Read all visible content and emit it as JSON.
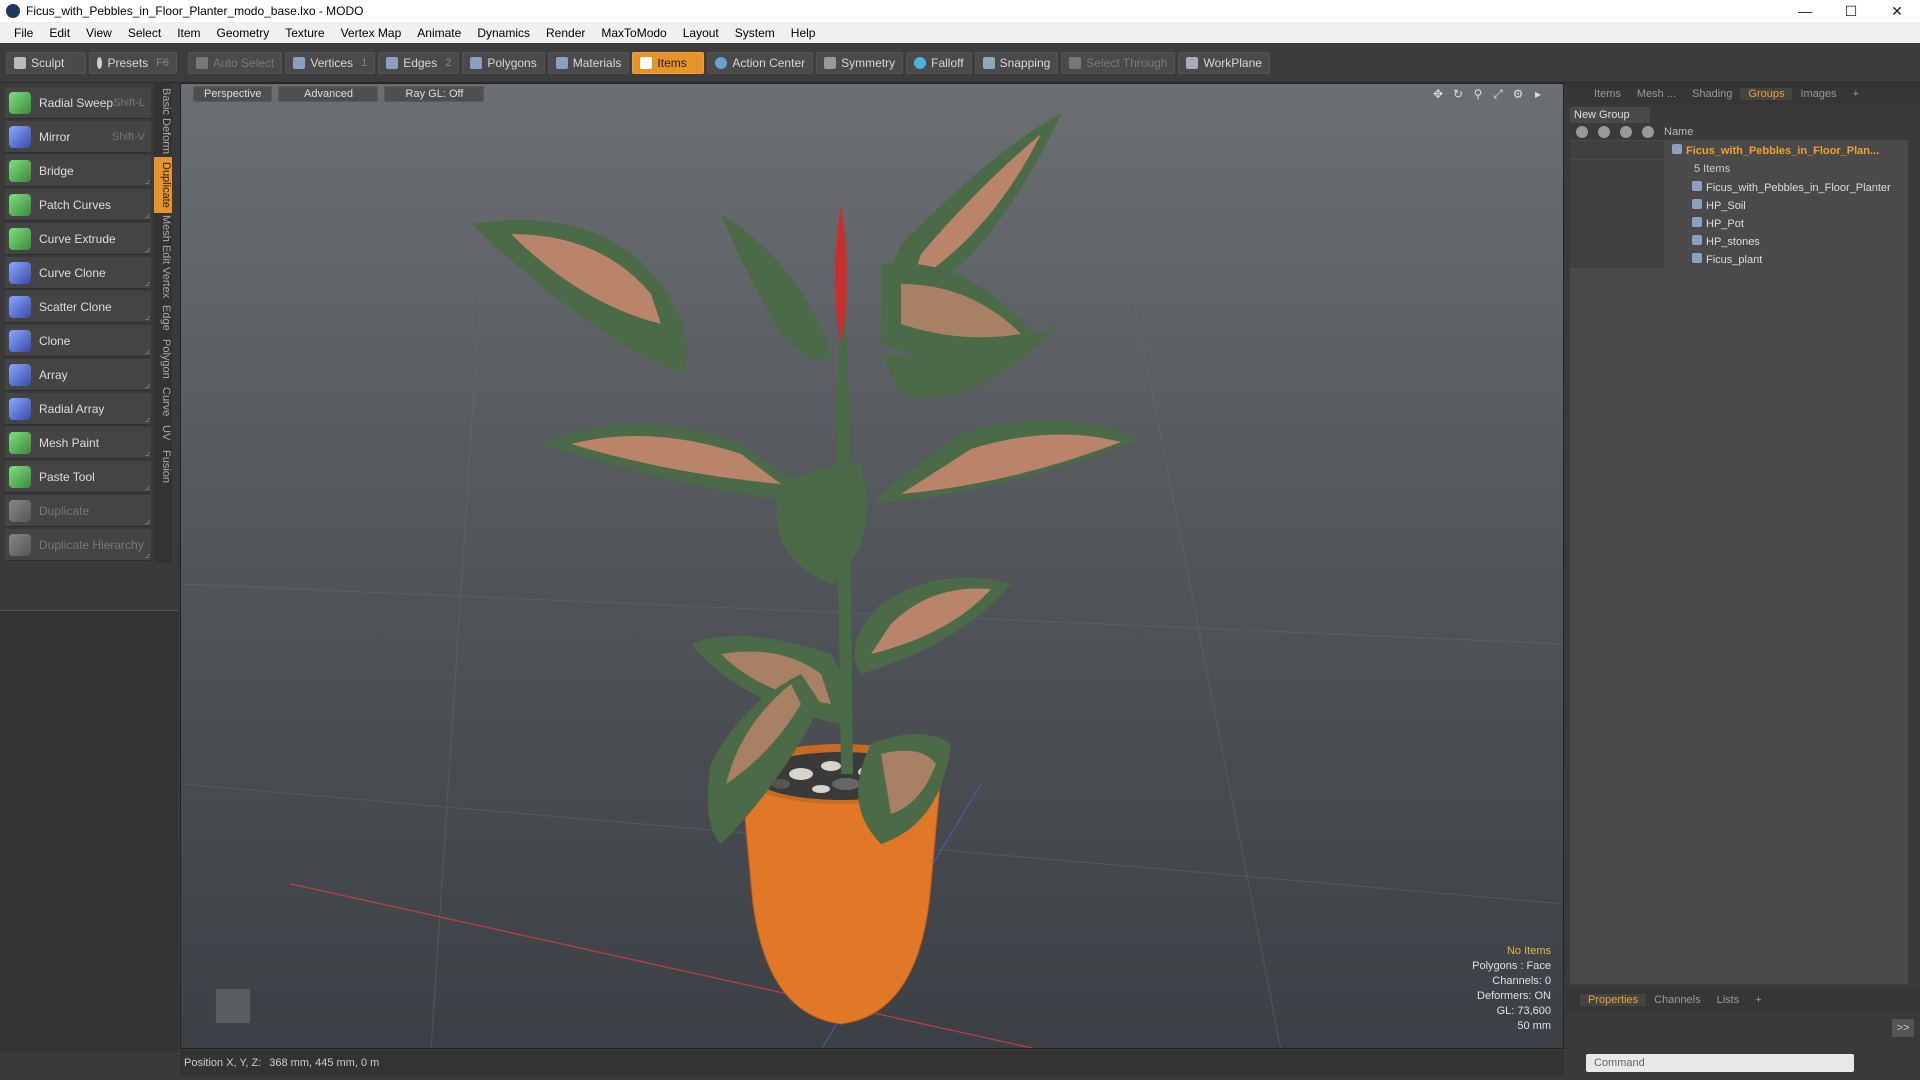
{
  "window": {
    "title": "Ficus_with_Pebbles_in_Floor_Planter_modo_base.lxo - MODO",
    "controls": [
      "—",
      "☐",
      "✕"
    ]
  },
  "menubar": [
    "File",
    "Edit",
    "View",
    "Select",
    "Item",
    "Geometry",
    "Texture",
    "Vertex Map",
    "Animate",
    "Dynamics",
    "Render",
    "MaxToModo",
    "Layout",
    "System",
    "Help"
  ],
  "toolbar": {
    "sculpt": "Sculpt",
    "presets": "Presets",
    "presets_key": "F6",
    "auto_select": "Auto Select",
    "vertices": "Vertices",
    "vertices_num": "1",
    "edges": "Edges",
    "edges_num": "2",
    "polygons": "Polygons",
    "materials": "Materials",
    "items": "Items",
    "action_center": "Action Center",
    "symmetry": "Symmetry",
    "falloff": "Falloff",
    "snapping": "Snapping",
    "select_through": "Select Through",
    "workplane": "WorkPlane"
  },
  "tools": [
    {
      "label": "Radial Sweep",
      "shortcut": "Shift-L",
      "icon": "radial-sweep-icon",
      "style": "green"
    },
    {
      "label": "Mirror",
      "shortcut": "Shift-V",
      "icon": "mirror-icon",
      "style": "blue"
    },
    {
      "label": "Bridge",
      "shortcut": "",
      "icon": "bridge-icon",
      "style": "green"
    },
    {
      "label": "Patch Curves",
      "shortcut": "",
      "icon": "patch-curves-icon",
      "style": "green"
    },
    {
      "label": "Curve Extrude",
      "shortcut": "",
      "icon": "curve-extrude-icon",
      "style": "green"
    },
    {
      "label": "Curve Clone",
      "shortcut": "",
      "icon": "curve-clone-icon",
      "style": "blue"
    },
    {
      "label": "Scatter Clone",
      "shortcut": "",
      "icon": "scatter-clone-icon",
      "style": "blue"
    },
    {
      "label": "Clone",
      "shortcut": "",
      "icon": "clone-icon",
      "style": "blue"
    },
    {
      "label": "Array",
      "shortcut": "",
      "icon": "array-icon",
      "style": "blue"
    },
    {
      "label": "Radial Array",
      "shortcut": "",
      "icon": "radial-array-icon",
      "style": "blue"
    },
    {
      "label": "Mesh Paint",
      "shortcut": "",
      "icon": "mesh-paint-icon",
      "style": "green"
    },
    {
      "label": "Paste Tool",
      "shortcut": "",
      "icon": "paste-tool-icon",
      "style": "green"
    },
    {
      "label": "Duplicate",
      "shortcut": "",
      "icon": "duplicate-icon",
      "style": "gray"
    },
    {
      "label": "Duplicate Hierarchy",
      "shortcut": "",
      "icon": "duplicate-hierarchy-icon",
      "style": "gray"
    }
  ],
  "vertical_tabs": [
    "Basic",
    "Deform",
    "Duplicate",
    "Mesh Edit",
    "Vertex",
    "Edge",
    "Polygon",
    "Curve",
    "UV",
    "Fusion"
  ],
  "viewport": {
    "tabs": [
      "Perspective",
      "Advanced",
      "Ray GL: Off"
    ],
    "info": {
      "selection": "No Items",
      "polygons": "Polygons : Face",
      "channels": "Channels: 0",
      "deformers": "Deformers: ON",
      "gl": "GL: 73,600",
      "focal": "50 mm"
    }
  },
  "statusbar": {
    "position_label": "Position X, Y, Z:",
    "position_value": "368 mm, 445 mm, 0 m"
  },
  "right_panel": {
    "tabs": [
      "Items",
      "Mesh ...",
      "Shading",
      "Groups",
      "Images"
    ],
    "active_tab": "Groups",
    "new_group": "New Group",
    "column_name": "Name",
    "group": {
      "name": "Ficus_with_Pebbles_in_Floor_Plan...",
      "count": "5 Items",
      "children": [
        "Ficus_with_Pebbles_in_Floor_Planter",
        "HP_Soil",
        "HP_Pot",
        "HP_stones",
        "Ficus_plant"
      ]
    },
    "bottom_tabs": [
      "Properties",
      "Channels",
      "Lists"
    ],
    "command_placeholder": "Command",
    "expand": ">>"
  },
  "colors": {
    "accent": "#e6932a",
    "pot": "#e07828",
    "leaf_green": "#4a6a48",
    "leaf_pink": "#e89078",
    "stem_red": "#c83030"
  }
}
